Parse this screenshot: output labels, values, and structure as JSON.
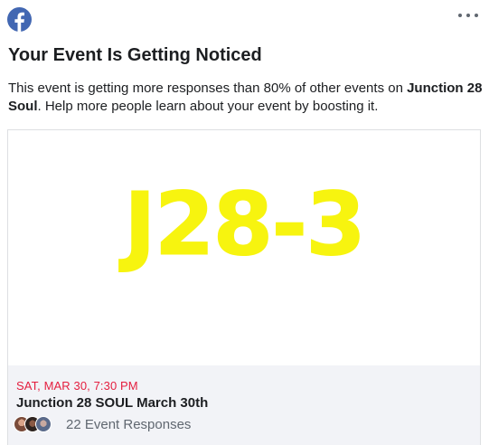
{
  "header": {
    "logo_icon": "facebook-logo-icon",
    "more_icon": "more-options-icon",
    "brand_color": "#4267b2"
  },
  "notice": {
    "title": "Your Event Is Getting Noticed",
    "desc_prefix": "This event is getting more responses than 80% of other events on ",
    "page_name": "Junction 28 Soul",
    "desc_suffix": ". Help more people learn about your event by boosting it."
  },
  "event": {
    "image_text": "J28-3",
    "image_text_color": "#f7f40f",
    "date": "SAT, MAR 30, 7:30 PM",
    "date_color": "#e41e3f",
    "name": "Junction 28 SOUL March 30th",
    "responses": "22 Event Responses",
    "avatar_icons": [
      "avatar-1",
      "avatar-2",
      "avatar-3"
    ]
  }
}
